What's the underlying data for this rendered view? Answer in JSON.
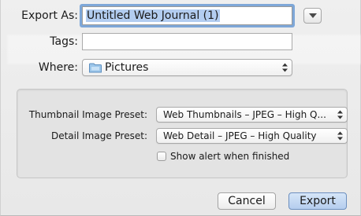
{
  "export_as": {
    "label": "Export As:",
    "value": "Untitled Web Journal (1)"
  },
  "tags": {
    "label": "Tags:",
    "value": ""
  },
  "where": {
    "label": "Where:",
    "value": "Pictures",
    "icon": "folder-icon"
  },
  "presets": {
    "thumbnail_label": "Thumbnail Image Preset:",
    "thumbnail_value": "Web Thumbnails – JPEG – High Q...",
    "detail_label": "Detail Image Preset:",
    "detail_value": "Web Detail – JPEG – High Quality"
  },
  "show_alert": {
    "label": "Show alert when finished",
    "checked": false
  },
  "buttons": {
    "cancel": "Cancel",
    "export": "Export"
  },
  "colors": {
    "focus_ring": "#7ea7d8",
    "default_button": "#b5cdee",
    "selection": "#b3cdf0"
  }
}
